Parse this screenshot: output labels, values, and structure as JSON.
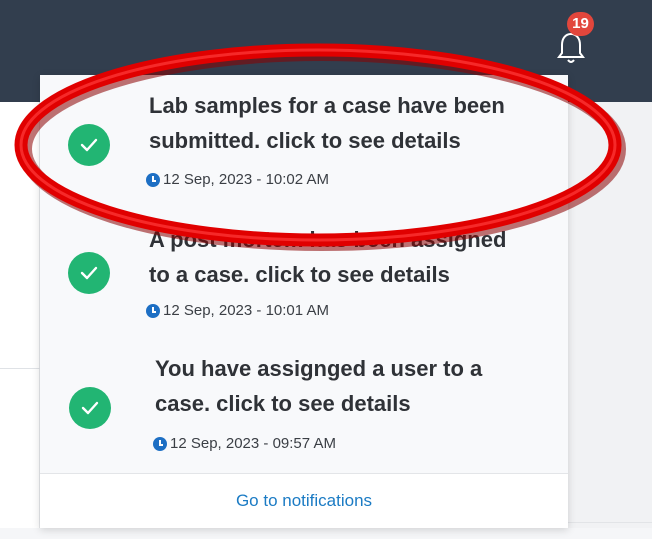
{
  "header": {
    "notification_count": "19"
  },
  "notifications": {
    "items": [
      {
        "line1": "Lab samples for a case have been",
        "line2": "submitted. click to see details",
        "time": "12 Sep, 2023 - 10:02 AM"
      },
      {
        "line1": "A post mortem has been assigned",
        "line2": "to a case. click to see details",
        "time": "12 Sep, 2023 - 10:01 AM"
      },
      {
        "line1": "You have assignged a user to a",
        "line2": "case. click to see details",
        "time": "12 Sep, 2023 - 09:57 AM"
      }
    ],
    "footer_link": "Go to notifications"
  },
  "colors": {
    "header_bg": "#323e4e",
    "badge": "#e2463c",
    "check": "#22b573",
    "link": "#1b7bc4",
    "annotation": "#e00000"
  },
  "icons": {
    "bell": "bell-icon",
    "check": "check-circle-icon",
    "clock": "clock-icon"
  }
}
